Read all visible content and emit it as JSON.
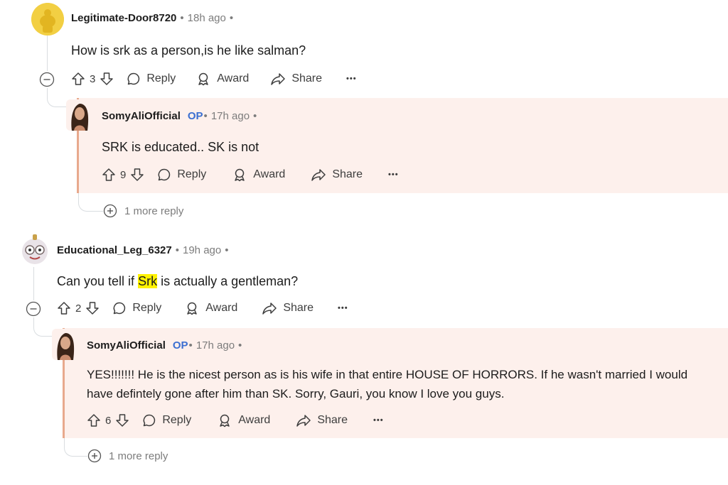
{
  "colors": {
    "reply_bg": "#fdf0ec",
    "reply_border": "#e8a98d",
    "op_blue": "#3b6fd1",
    "highlight": "#fff200"
  },
  "comments": [
    {
      "author": "Legitimate-Door8720",
      "sep1": "•",
      "time": "18h ago",
      "sep2": "•",
      "body": "How is srk as a person,is he like salman?",
      "votes": "3",
      "reply_label": "Reply",
      "award_label": "Award",
      "share_label": "Share",
      "more_label": "•••",
      "reply": {
        "author": "SomyAliOfficial",
        "op": "OP",
        "sep1": "•",
        "time": "17h ago",
        "sep2": "•",
        "body": "SRK is educated.. SK is not",
        "votes": "9",
        "reply_label": "Reply",
        "award_label": "Award",
        "share_label": "Share",
        "more_label": "•••"
      },
      "more_replies": "1 more reply"
    },
    {
      "author": "Educational_Leg_6327",
      "sep1": "•",
      "time": "19h ago",
      "sep2": "•",
      "body_before": "Can you tell if ",
      "body_highlight": "Srk",
      "body_after": " is actually a gentleman?",
      "votes": "2",
      "reply_label": "Reply",
      "award_label": "Award",
      "share_label": "Share",
      "more_label": "•••",
      "reply": {
        "author": "SomyAliOfficial",
        "op": "OP",
        "sep1": "•",
        "time": "17h ago",
        "sep2": "•",
        "body_line1": "YES!!!!!!! He is the nicest person as is his wife in that entire HOUSE OF HORRORS. If he wasn't married I would",
        "body_line2": "have defintely gone after him than SK. Sorry, Gauri, you know I love you guys.",
        "votes": "6",
        "reply_label": "Reply",
        "award_label": "Award",
        "share_label": "Share",
        "more_label": "•••"
      },
      "more_replies": "1 more reply"
    }
  ]
}
